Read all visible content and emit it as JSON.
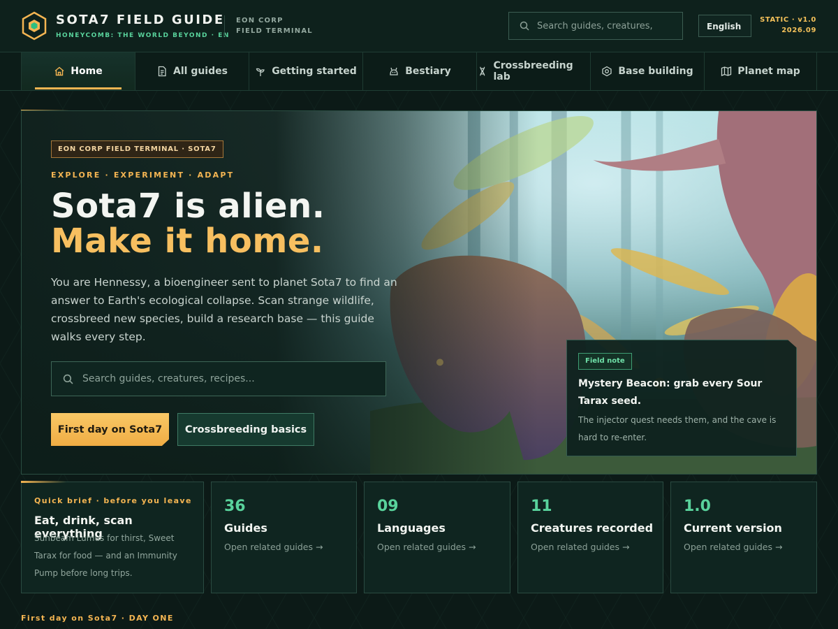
{
  "header": {
    "title": "SOTA7 FIELD GUIDE",
    "subtitle": "HONEYCOMB: THE WORLD BEYOND · EN",
    "corp_line1": "EON CORP",
    "corp_line2": "FIELD TERMINAL",
    "search_placeholder": "Search guides, creatures,",
    "language": "English",
    "version_line1": "STATIC · v1.0",
    "version_line2": "2026.09"
  },
  "nav": {
    "items": [
      {
        "label": "Home",
        "icon": "home-icon",
        "active": true
      },
      {
        "label": "All guides",
        "icon": "document-icon"
      },
      {
        "label": "Getting started",
        "icon": "sprout-icon"
      },
      {
        "label": "Bestiary",
        "icon": "creature-icon"
      },
      {
        "label": "Crossbreeding lab",
        "icon": "dna-icon"
      },
      {
        "label": "Base building",
        "icon": "hexagon-icon"
      },
      {
        "label": "Planet map",
        "icon": "map-icon"
      }
    ]
  },
  "hero": {
    "badge": "EON CORP FIELD TERMINAL · SOTA7",
    "eyebrow": "EXPLORE · EXPERIMENT · ADAPT",
    "headline_line1": "Sota7 is alien.",
    "headline_line2": "Make it home.",
    "description": "You are Hennessy, a bioengineer sent to planet Sota7 to find an answer to Earth's ecological collapse. Scan strange wildlife, crossbreed new species, build a research base — this guide walks every step.",
    "search_placeholder": "Search guides, creatures, recipes...",
    "primary_button": "First day on Sota7",
    "secondary_button": "Crossbreeding basics"
  },
  "field_note": {
    "badge": "Field note",
    "title": "Mystery Beacon: grab every Sour Tarax seed.",
    "text": "The injector quest needs them, and the cave is hard to re-enter."
  },
  "brief": {
    "label": "Quick brief · before you leave",
    "title": "Eat, drink, scan everything",
    "text": "Sunbeam Lumus for thirst, Sweet Tarax for food — and an Immunity Pump before long trips."
  },
  "stats": [
    {
      "value": "36",
      "label": "Guides",
      "link": "Open related guides →"
    },
    {
      "value": "09",
      "label": "Languages",
      "link": "Open related guides →"
    },
    {
      "value": "11",
      "label": "Creatures recorded",
      "link": "Open related guides →"
    },
    {
      "value": "1.0",
      "label": "Current version",
      "link": "Open related guides →"
    }
  ],
  "footer_strip": "First day on Sota7 · DAY ONE",
  "colors": {
    "background": "#0c1a17",
    "accent_gold": "#f4b552",
    "accent_green": "#59d39c",
    "panel": "#0f2520"
  }
}
